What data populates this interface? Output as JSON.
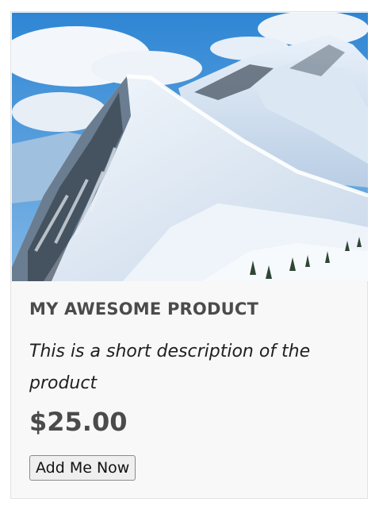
{
  "product": {
    "image_alt": "snowy-mountain-photo",
    "title": "MY AWESOME PRODUCT",
    "description": "This is a short description of the product",
    "price": "$25.00",
    "button_label": "Add Me Now"
  }
}
